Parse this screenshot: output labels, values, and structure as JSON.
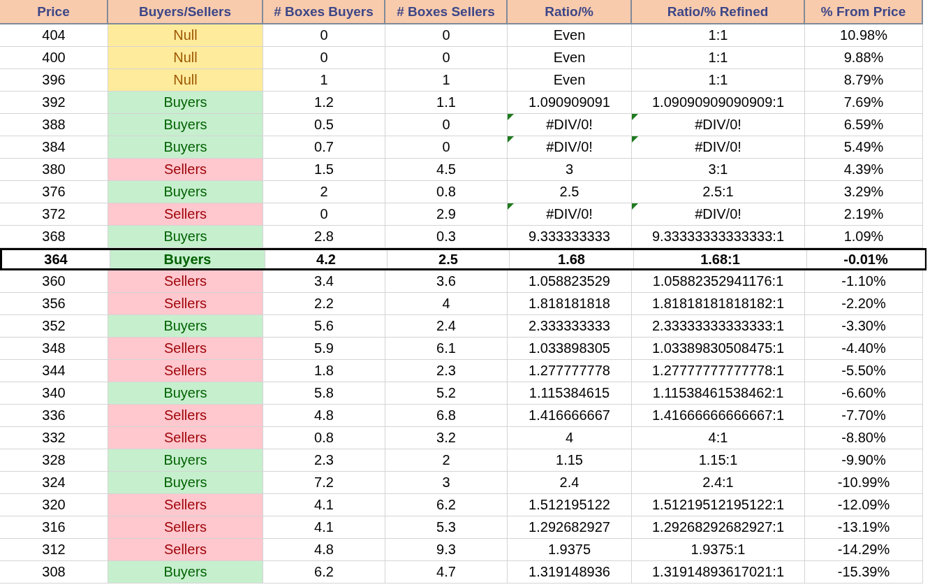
{
  "columns": [
    "Price",
    "Buyers/Sellers",
    "# Boxes Buyers",
    "# Boxes Sellers",
    "Ratio/%",
    "Ratio/% Refined",
    "% From Price"
  ],
  "rows": [
    {
      "price": "404",
      "side": {
        "kind": "null",
        "label": "Null"
      },
      "buyers": "0",
      "sellers": "0",
      "ratio": "Even",
      "refined": "1:1",
      "from_price": "10.98%",
      "current": false,
      "ratio_flagged": false,
      "refined_flagged": false
    },
    {
      "price": "400",
      "side": {
        "kind": "null",
        "label": "Null"
      },
      "buyers": "0",
      "sellers": "0",
      "ratio": "Even",
      "refined": "1:1",
      "from_price": "9.88%",
      "current": false,
      "ratio_flagged": false,
      "refined_flagged": false
    },
    {
      "price": "396",
      "side": {
        "kind": "null",
        "label": "Null"
      },
      "buyers": "1",
      "sellers": "1",
      "ratio": "Even",
      "refined": "1:1",
      "from_price": "8.79%",
      "current": false,
      "ratio_flagged": false,
      "refined_flagged": false
    },
    {
      "price": "392",
      "side": {
        "kind": "buyers",
        "label": "Buyers"
      },
      "buyers": "1.2",
      "sellers": "1.1",
      "ratio": "1.090909091",
      "refined": "1.09090909090909:1",
      "from_price": "7.69%",
      "current": false,
      "ratio_flagged": false,
      "refined_flagged": false
    },
    {
      "price": "388",
      "side": {
        "kind": "buyers",
        "label": "Buyers"
      },
      "buyers": "0.5",
      "sellers": "0",
      "ratio": "#DIV/0!",
      "refined": "#DIV/0!",
      "from_price": "6.59%",
      "current": false,
      "ratio_flagged": true,
      "refined_flagged": true
    },
    {
      "price": "384",
      "side": {
        "kind": "buyers",
        "label": "Buyers"
      },
      "buyers": "0.7",
      "sellers": "0",
      "ratio": "#DIV/0!",
      "refined": "#DIV/0!",
      "from_price": "5.49%",
      "current": false,
      "ratio_flagged": true,
      "refined_flagged": true
    },
    {
      "price": "380",
      "side": {
        "kind": "sellers",
        "label": "Sellers"
      },
      "buyers": "1.5",
      "sellers": "4.5",
      "ratio": "3",
      "refined": "3:1",
      "from_price": "4.39%",
      "current": false,
      "ratio_flagged": false,
      "refined_flagged": false
    },
    {
      "price": "376",
      "side": {
        "kind": "buyers",
        "label": "Buyers"
      },
      "buyers": "2",
      "sellers": "0.8",
      "ratio": "2.5",
      "refined": "2.5:1",
      "from_price": "3.29%",
      "current": false,
      "ratio_flagged": false,
      "refined_flagged": false
    },
    {
      "price": "372",
      "side": {
        "kind": "sellers",
        "label": "Sellers"
      },
      "buyers": "0",
      "sellers": "2.9",
      "ratio": "#DIV/0!",
      "refined": "#DIV/0!",
      "from_price": "2.19%",
      "current": false,
      "ratio_flagged": true,
      "refined_flagged": true
    },
    {
      "price": "368",
      "side": {
        "kind": "buyers",
        "label": "Buyers"
      },
      "buyers": "2.8",
      "sellers": "0.3",
      "ratio": "9.333333333",
      "refined": "9.33333333333333:1",
      "from_price": "1.09%",
      "current": false,
      "ratio_flagged": false,
      "refined_flagged": false
    },
    {
      "price": "364",
      "side": {
        "kind": "buyers",
        "label": "Buyers"
      },
      "buyers": "4.2",
      "sellers": "2.5",
      "ratio": "1.68",
      "refined": "1.68:1",
      "from_price": "-0.01%",
      "current": true,
      "ratio_flagged": false,
      "refined_flagged": false
    },
    {
      "price": "360",
      "side": {
        "kind": "sellers",
        "label": "Sellers"
      },
      "buyers": "3.4",
      "sellers": "3.6",
      "ratio": "1.058823529",
      "refined": "1.05882352941176:1",
      "from_price": "-1.10%",
      "current": false,
      "ratio_flagged": false,
      "refined_flagged": false
    },
    {
      "price": "356",
      "side": {
        "kind": "sellers",
        "label": "Sellers"
      },
      "buyers": "2.2",
      "sellers": "4",
      "ratio": "1.818181818",
      "refined": "1.81818181818182:1",
      "from_price": "-2.20%",
      "current": false,
      "ratio_flagged": false,
      "refined_flagged": false
    },
    {
      "price": "352",
      "side": {
        "kind": "buyers",
        "label": "Buyers"
      },
      "buyers": "5.6",
      "sellers": "2.4",
      "ratio": "2.333333333",
      "refined": "2.33333333333333:1",
      "from_price": "-3.30%",
      "current": false,
      "ratio_flagged": false,
      "refined_flagged": false
    },
    {
      "price": "348",
      "side": {
        "kind": "sellers",
        "label": "Sellers"
      },
      "buyers": "5.9",
      "sellers": "6.1",
      "ratio": "1.033898305",
      "refined": "1.03389830508475:1",
      "from_price": "-4.40%",
      "current": false,
      "ratio_flagged": false,
      "refined_flagged": false
    },
    {
      "price": "344",
      "side": {
        "kind": "sellers",
        "label": "Sellers"
      },
      "buyers": "1.8",
      "sellers": "2.3",
      "ratio": "1.277777778",
      "refined": "1.27777777777778:1",
      "from_price": "-5.50%",
      "current": false,
      "ratio_flagged": false,
      "refined_flagged": false
    },
    {
      "price": "340",
      "side": {
        "kind": "buyers",
        "label": "Buyers"
      },
      "buyers": "5.8",
      "sellers": "5.2",
      "ratio": "1.115384615",
      "refined": "1.11538461538462:1",
      "from_price": "-6.60%",
      "current": false,
      "ratio_flagged": false,
      "refined_flagged": false
    },
    {
      "price": "336",
      "side": {
        "kind": "sellers",
        "label": "Sellers"
      },
      "buyers": "4.8",
      "sellers": "6.8",
      "ratio": "1.416666667",
      "refined": "1.41666666666667:1",
      "from_price": "-7.70%",
      "current": false,
      "ratio_flagged": false,
      "refined_flagged": false
    },
    {
      "price": "332",
      "side": {
        "kind": "sellers",
        "label": "Sellers"
      },
      "buyers": "0.8",
      "sellers": "3.2",
      "ratio": "4",
      "refined": "4:1",
      "from_price": "-8.80%",
      "current": false,
      "ratio_flagged": false,
      "refined_flagged": false
    },
    {
      "price": "328",
      "side": {
        "kind": "buyers",
        "label": "Buyers"
      },
      "buyers": "2.3",
      "sellers": "2",
      "ratio": "1.15",
      "refined": "1.15:1",
      "from_price": "-9.90%",
      "current": false,
      "ratio_flagged": false,
      "refined_flagged": false
    },
    {
      "price": "324",
      "side": {
        "kind": "buyers",
        "label": "Buyers"
      },
      "buyers": "7.2",
      "sellers": "3",
      "ratio": "2.4",
      "refined": "2.4:1",
      "from_price": "-10.99%",
      "current": false,
      "ratio_flagged": false,
      "refined_flagged": false
    },
    {
      "price": "320",
      "side": {
        "kind": "sellers",
        "label": "Sellers"
      },
      "buyers": "4.1",
      "sellers": "6.2",
      "ratio": "1.512195122",
      "refined": "1.51219512195122:1",
      "from_price": "-12.09%",
      "current": false,
      "ratio_flagged": false,
      "refined_flagged": false
    },
    {
      "price": "316",
      "side": {
        "kind": "sellers",
        "label": "Sellers"
      },
      "buyers": "4.1",
      "sellers": "5.3",
      "ratio": "1.292682927",
      "refined": "1.29268292682927:1",
      "from_price": "-13.19%",
      "current": false,
      "ratio_flagged": false,
      "refined_flagged": false
    },
    {
      "price": "312",
      "side": {
        "kind": "sellers",
        "label": "Sellers"
      },
      "buyers": "4.8",
      "sellers": "9.3",
      "ratio": "1.9375",
      "refined": "1.9375:1",
      "from_price": "-14.29%",
      "current": false,
      "ratio_flagged": false,
      "refined_flagged": false
    },
    {
      "price": "308",
      "side": {
        "kind": "buyers",
        "label": "Buyers"
      },
      "buyers": "6.2",
      "sellers": "4.7",
      "ratio": "1.319148936",
      "refined": "1.31914893617021:1",
      "from_price": "-15.39%",
      "current": false,
      "ratio_flagged": false,
      "refined_flagged": false
    }
  ]
}
